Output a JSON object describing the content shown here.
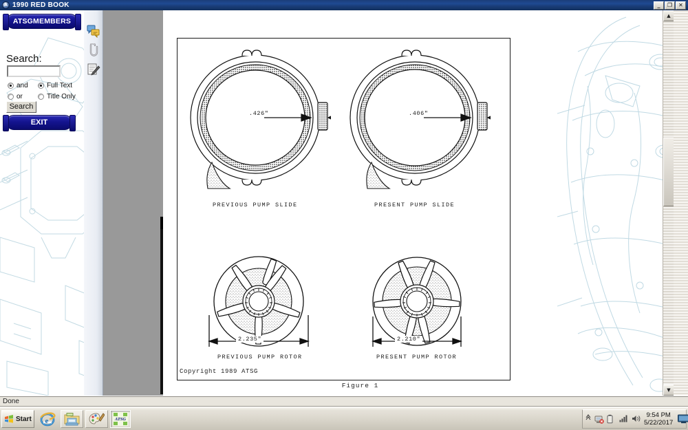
{
  "window": {
    "title": "1990 RED BOOK",
    "app_icon": "acrobat-icon",
    "minimize_label": "_",
    "restore_label": "❐",
    "close_label": "✕"
  },
  "sidebar": {
    "members_button": "ATSGMEMBERS",
    "search_label": "Search:",
    "search_value": "",
    "search_placeholder": "",
    "radios": [
      {
        "name": "and",
        "label": "and",
        "selected": true
      },
      {
        "name": "or",
        "label": "or",
        "selected": false
      },
      {
        "name": "full-text",
        "label": "Full Text",
        "selected": true
      },
      {
        "name": "title-only",
        "label": "Title Only",
        "selected": false
      }
    ],
    "search_button": "Search",
    "exit_button": "EXIT"
  },
  "rail": {
    "icons": [
      "comments-icon",
      "attachments-icon",
      "signature-icon"
    ]
  },
  "document": {
    "figure_caption": "Figure 1",
    "copyright": "Copyright 1989  ATSG",
    "drawings": [
      {
        "id": "previous-pump-slide",
        "label": "PREVIOUS PUMP SLIDE",
        "dimension": ".426\""
      },
      {
        "id": "present-pump-slide",
        "label": "PRESENT PUMP SLIDE",
        "dimension": ".406\""
      },
      {
        "id": "previous-pump-rotor",
        "label": "PREVIOUS PUMP ROTOR",
        "dimension": "2.235\""
      },
      {
        "id": "present-pump-rotor",
        "label": "PRESENT PUMP ROTOR",
        "dimension": "2.210\""
      }
    ]
  },
  "scrollbar": {
    "up_arrow": "▲",
    "down_arrow": "▼"
  },
  "status": {
    "text": "Done"
  },
  "taskbar": {
    "start_label": "Start",
    "quick_launch": [
      {
        "name": "internet-explorer-icon",
        "framed": false,
        "active": false
      },
      {
        "name": "file-explorer-icon",
        "framed": true,
        "active": false
      },
      {
        "name": "paint-icon",
        "framed": true,
        "active": false
      },
      {
        "name": "atsg-app-icon",
        "framed": false,
        "active": true,
        "label": "ATSG"
      }
    ],
    "tray": {
      "overflow_icon": "chevron-up-icon",
      "icons": [
        "network-disconnected-icon",
        "battery-icon",
        "signal-bars-icon",
        "volume-icon"
      ],
      "time": "9:54 PM",
      "date": "5/22/2017",
      "show_desktop_icon": "monitor-icon"
    }
  },
  "colors": {
    "titlebar": "#1f4a92",
    "viewer_bg": "#999999",
    "page_bg": "#ffffff",
    "taskbar": "#d9d5ca",
    "blueprint_line": "#bcd6e0",
    "button_blue": "#14148f"
  }
}
